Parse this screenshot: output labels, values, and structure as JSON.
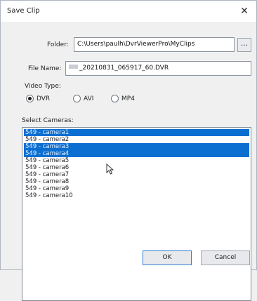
{
  "dialog": {
    "title": "Save Clip",
    "close_glyph": "✕"
  },
  "folder": {
    "label": "Folder:",
    "value": "C:\\Users\\paulh\\DvrViewerPro\\MyClips",
    "browse_label": "..."
  },
  "file_name": {
    "label": "File Name:",
    "value": "_20210831_065917_60.DVR"
  },
  "video_type": {
    "label": "Video Type:",
    "options": [
      {
        "label": "DVR",
        "checked": true
      },
      {
        "label": "AVI",
        "checked": false
      },
      {
        "label": "MP4",
        "checked": false
      }
    ]
  },
  "cameras": {
    "label": "Select Cameras:",
    "items": [
      {
        "label": "549 - camera1",
        "selected": true
      },
      {
        "label": "549 - camera2",
        "selected": false
      },
      {
        "label": "549 - camera3",
        "selected": true
      },
      {
        "label": "549 - camera4",
        "selected": true
      },
      {
        "label": "549 - camera5",
        "selected": false
      },
      {
        "label": "549 - camera6",
        "selected": false
      },
      {
        "label": "549 - camera7",
        "selected": false
      },
      {
        "label": "549 - camera8",
        "selected": false
      },
      {
        "label": "549 - camera9",
        "selected": false
      },
      {
        "label": "549 - camera10",
        "selected": false
      }
    ]
  },
  "buttons": {
    "ok": "OK",
    "cancel": "Cancel"
  },
  "colors": {
    "selection": "#0b6fd1",
    "background": "#f0f0f0"
  }
}
